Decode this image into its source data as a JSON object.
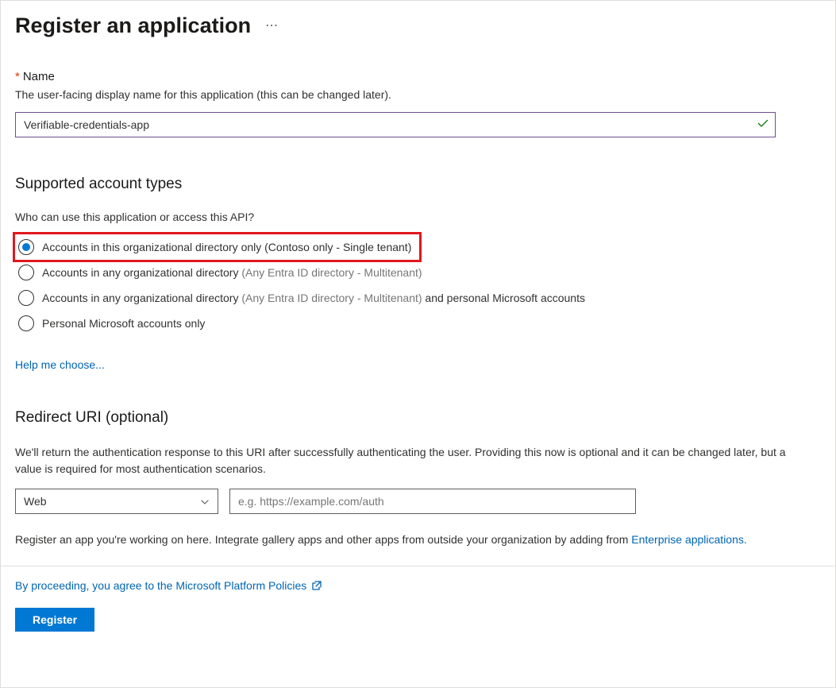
{
  "header": {
    "title": "Register an application"
  },
  "name": {
    "label": "Name",
    "description": "The user-facing display name for this application (this can be changed later).",
    "value": "Verifiable-credentials-app"
  },
  "accountTypes": {
    "heading": "Supported account types",
    "sub": "Who can use this application or access this API?",
    "options": [
      {
        "text": "Accounts in this organizational directory only (Contoso only - Single tenant)",
        "muted": "",
        "suffix": "",
        "selected": true,
        "highlight": true
      },
      {
        "text": "Accounts in any organizational directory ",
        "muted": "(Any Entra ID directory - Multitenant)",
        "suffix": "",
        "selected": false,
        "highlight": false
      },
      {
        "text": "Accounts in any organizational directory ",
        "muted": "(Any Entra ID directory - Multitenant)",
        "suffix": "  and personal Microsoft accounts",
        "selected": false,
        "highlight": false
      },
      {
        "text": "Personal Microsoft accounts only",
        "muted": "",
        "suffix": "",
        "selected": false,
        "highlight": false
      }
    ],
    "helpLink": "Help me choose..."
  },
  "redirect": {
    "heading": "Redirect URI (optional)",
    "description": "We'll return the authentication response to this URI after successfully authenticating the user. Providing this now is optional and it can be changed later, but a value is required for most authentication scenarios.",
    "platformSelected": "Web",
    "uriPlaceholder": "e.g. https://example.com/auth",
    "uriValue": ""
  },
  "footerNote": {
    "prefix": "Register an app you're working on here. Integrate gallery apps and other apps from outside your organization by adding from ",
    "link": "Enterprise applications."
  },
  "agreement": {
    "text": "By proceeding, you agree to the Microsoft Platform Policies"
  },
  "actions": {
    "register": "Register"
  }
}
